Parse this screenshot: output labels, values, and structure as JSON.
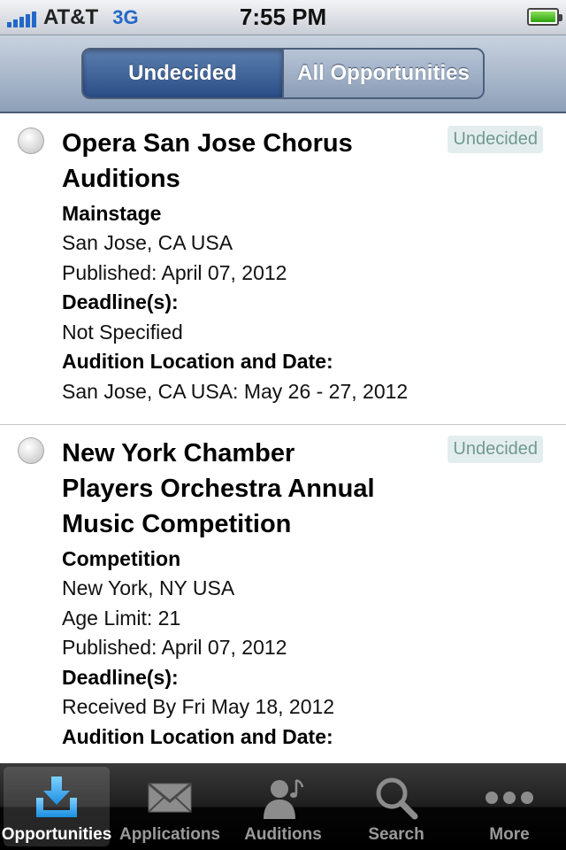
{
  "status_bar": {
    "carrier": "AT&T",
    "network": "3G",
    "time": "7:55 PM"
  },
  "segmented_control": {
    "options": [
      "Undecided",
      "All Opportunities"
    ],
    "selected": "Undecided"
  },
  "list": [
    {
      "title": "Opera San Jose Chorus Auditions",
      "badge": "Undecided",
      "type": "Mainstage",
      "location": "San Jose, CA USA",
      "published": "Published: April 07, 2012",
      "deadline_label": "Deadline(s):",
      "deadline": "Not Specified",
      "audition_label": "Audition Location and Date:",
      "audition": "San Jose, CA USA: May 26 - 27, 2012"
    },
    {
      "title": "New York Chamber Players Orchestra Annual Music Competition",
      "badge": "Undecided",
      "type": "Competition",
      "location": "New York, NY USA",
      "age_limit": "Age Limit: 21",
      "published": "Published: April 07, 2012",
      "deadline_label": "Deadline(s):",
      "deadline": "Received By Fri May 18, 2012",
      "audition_label": "Audition Location and Date:"
    }
  ],
  "tab_bar": {
    "tabs": [
      {
        "label": "Opportunities",
        "icon": "tray-download-icon",
        "active": true
      },
      {
        "label": "Applications",
        "icon": "envelope-icon",
        "active": false
      },
      {
        "label": "Auditions",
        "icon": "person-music-icon",
        "active": false
      },
      {
        "label": "Search",
        "icon": "magnifier-icon",
        "active": false
      },
      {
        "label": "More",
        "icon": "ellipsis-icon",
        "active": false
      }
    ]
  },
  "colors": {
    "accent_blue": "#2368c8",
    "badge_text": "#6f9a8e",
    "badge_bg": "#e4eded"
  }
}
